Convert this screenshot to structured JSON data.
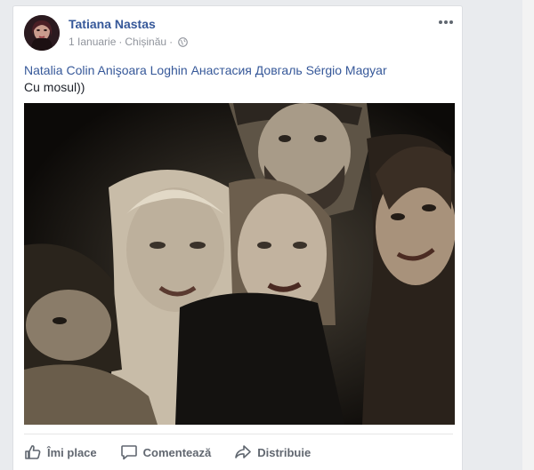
{
  "post": {
    "author": "Tatiana Nastas",
    "date": "1 Ianuarie",
    "separator1": "·",
    "location": "Chișinău",
    "separator2": "·",
    "tagged": [
      "Natalia Colin",
      "Anişoara Loghin",
      "Анастасия Довгаль",
      "Sérgio Magyar"
    ],
    "message": "Cu mosul))"
  },
  "actions": {
    "like": "Îmi place",
    "comment": "Comentează",
    "share": "Distribuie"
  },
  "icons": {
    "more": "more-options-icon",
    "privacy": "globe-icon",
    "like": "thumbs-up-icon",
    "comment": "comment-bubble-icon",
    "share": "share-arrow-icon"
  },
  "colors": {
    "link_blue": "#365899",
    "meta_gray": "#90949c",
    "action_gray": "#616770",
    "page_bg": "#e9ebee"
  }
}
